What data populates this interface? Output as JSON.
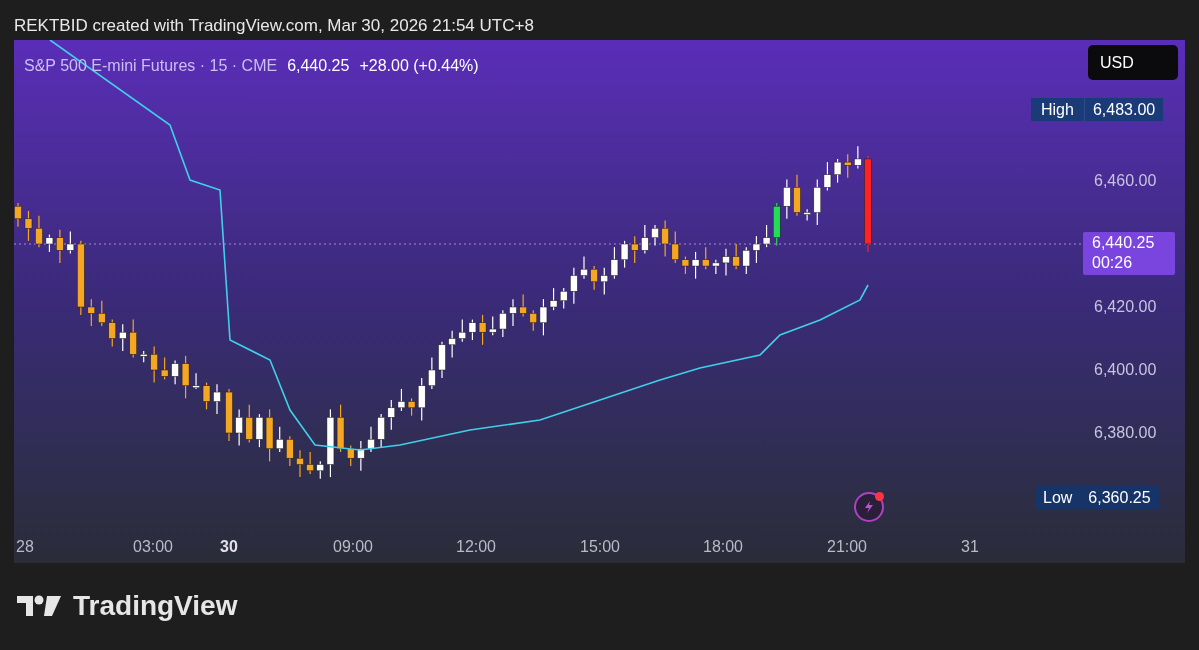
{
  "header": {
    "credit": "REKTBID created with TradingView.com, Mar 30, 2026 21:54 UTC+8"
  },
  "chart": {
    "symbol": "S&P 500 E-mini Futures · 15 · CME",
    "last_price": "6,440.25",
    "change": "+28.00 (+0.44%)",
    "currency": "USD",
    "high": {
      "label": "High",
      "value": "6,483.00"
    },
    "price_ticks": [
      "6,460.00",
      "6,420.00",
      "6,400.00",
      "6,380.00"
    ],
    "current": {
      "price": "6,440.25",
      "countdown": "00:26"
    },
    "low": {
      "label": "Low",
      "value": "6,360.25"
    },
    "time_axis": [
      {
        "label": "28",
        "kind": "day"
      },
      {
        "label": "03:00",
        "kind": "time"
      },
      {
        "label": "30",
        "kind": "day_bold"
      },
      {
        "label": "09:00",
        "kind": "time"
      },
      {
        "label": "12:00",
        "kind": "time"
      },
      {
        "label": "15:00",
        "kind": "time"
      },
      {
        "label": "18:00",
        "kind": "time"
      },
      {
        "label": "21:00",
        "kind": "time"
      },
      {
        "label": "31",
        "kind": "day"
      }
    ]
  },
  "footer": {
    "brand": "TradingView"
  }
}
